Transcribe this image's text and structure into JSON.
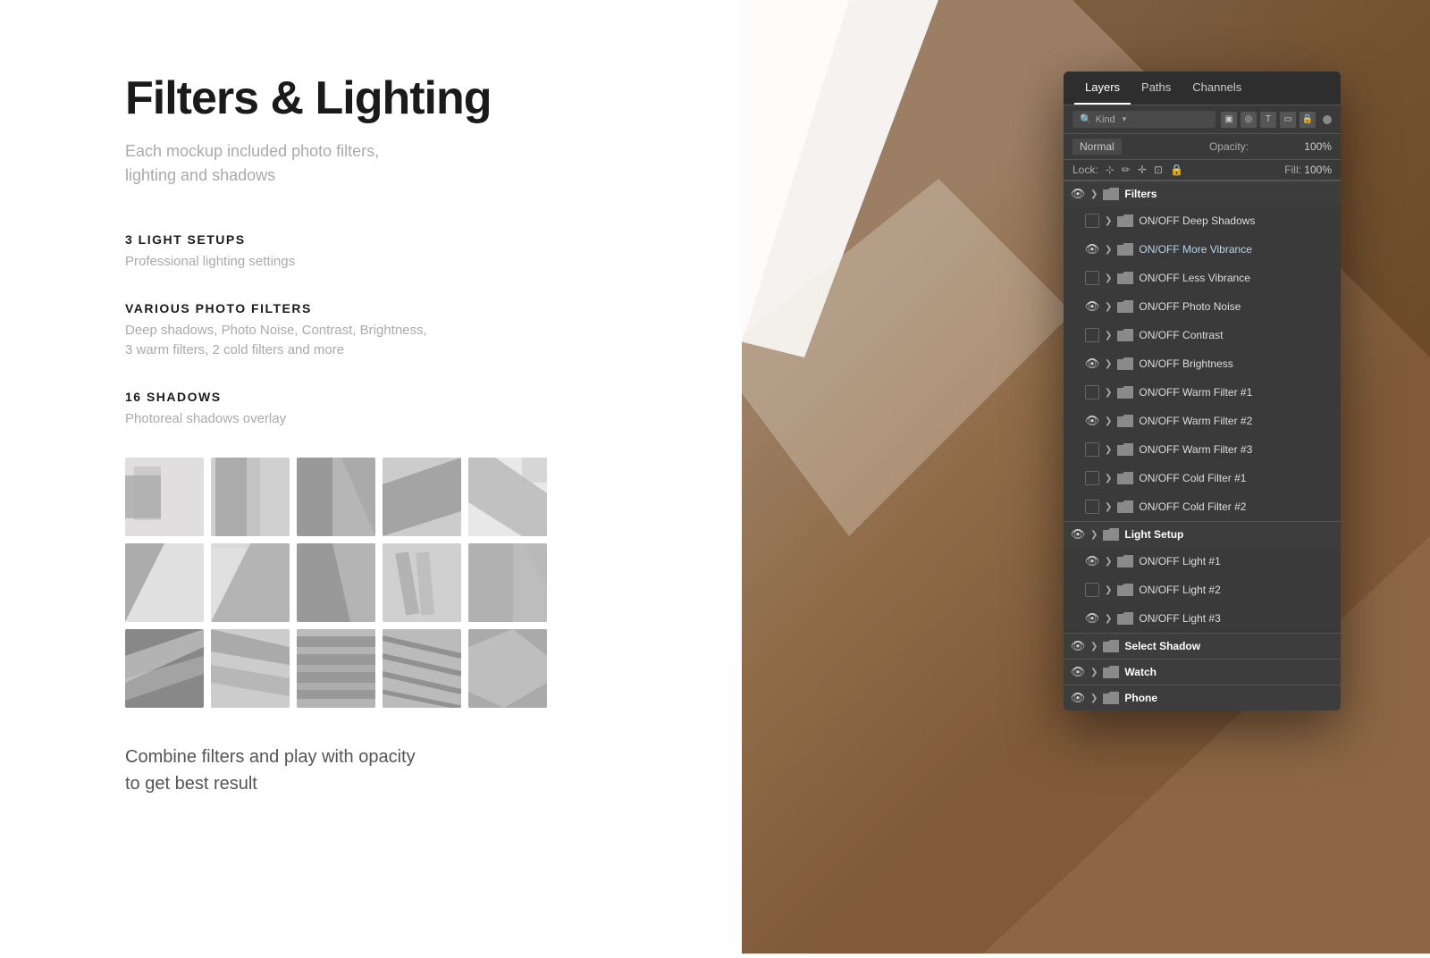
{
  "background": {
    "shadow_color": "#8B6340"
  },
  "content": {
    "main_title": "Filters & Lighting",
    "subtitle_line1": "Each mockup included photo filters,",
    "subtitle_line2": "lighting and shadows",
    "features": [
      {
        "id": "light_setups",
        "title": "3 LIGHT SETUPS",
        "description": "Professional lighting settings"
      },
      {
        "id": "photo_filters",
        "title": "VARIOUS PHOTO FILTERS",
        "description_line1": "Deep shadows, Photo Noise, Contrast, Brightness,",
        "description_line2": "3 warm filters, 2 cold filters and more"
      },
      {
        "id": "shadows",
        "title": "16 SHADOWS",
        "description": "Photoreal shadows overlay"
      }
    ],
    "combine_text_line1": "Combine filters and play with opacity",
    "combine_text_line2": "to get best result"
  },
  "photoshop_panel": {
    "tabs": [
      {
        "label": "Layers",
        "active": true
      },
      {
        "label": "Paths",
        "active": false
      },
      {
        "label": "Channels",
        "active": false
      }
    ],
    "search_placeholder": "Kind",
    "blend_mode": "Normal",
    "opacity_label": "Opacity:",
    "lock_label": "Lock:",
    "fill_label": "Fill:",
    "layer_groups": [
      {
        "id": "filters_group",
        "name": "Filters",
        "visible": true,
        "expanded": true,
        "layers": [
          {
            "name": "ON/OFF Deep Shadows",
            "visible": false
          },
          {
            "name": "ON/OFF More Vibrance",
            "visible": true,
            "vibrance": true
          },
          {
            "name": "ON/OFF Less Vibrance",
            "visible": false
          },
          {
            "name": "ON/OFF Photo Noise",
            "visible": true
          },
          {
            "name": "ON/OFF Contrast",
            "visible": false
          },
          {
            "name": "ON/OFF Brightness",
            "visible": true
          },
          {
            "name": "ON/OFF Warm Filter #1",
            "visible": false
          },
          {
            "name": "ON/OFF Warm Filter #2",
            "visible": true
          },
          {
            "name": "ON/OFF Warm Filter #3",
            "visible": false
          },
          {
            "name": "ON/OFF Cold Filter #1",
            "visible": false
          },
          {
            "name": "ON/OFF Cold Filter #2",
            "visible": false
          }
        ]
      },
      {
        "id": "light_setup_group",
        "name": "Light Setup",
        "visible": true,
        "expanded": true,
        "layers": [
          {
            "name": "ON/OFF Light #1",
            "visible": true
          },
          {
            "name": "ON/OFF Light #2",
            "visible": false
          },
          {
            "name": "ON/OFF Light #3",
            "visible": true
          }
        ]
      },
      {
        "id": "select_shadow_group",
        "name": "Select Shadow",
        "visible": true,
        "expanded": false,
        "layers": []
      },
      {
        "id": "watch_group",
        "name": "Watch",
        "visible": true,
        "expanded": false,
        "layers": []
      },
      {
        "id": "phone_group",
        "name": "Phone",
        "visible": true,
        "expanded": false,
        "layers": []
      }
    ]
  }
}
